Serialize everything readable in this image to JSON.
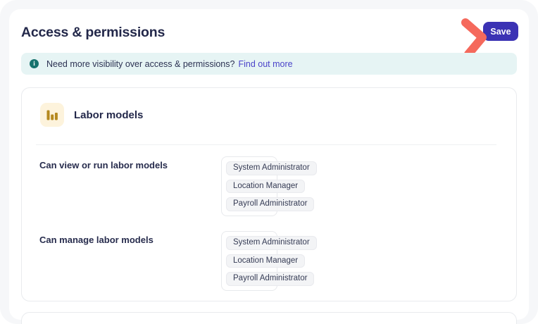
{
  "header": {
    "title": "Access & permissions",
    "save_button": "Save"
  },
  "banner": {
    "icon_glyph": "i",
    "text": "Need more visibility over access & permissions?",
    "link_text": "Find out more"
  },
  "section": {
    "icon": "bar-chart-icon",
    "title": "Labor models",
    "rows": [
      {
        "label": "Can view or run labor models",
        "tags": [
          "System Administrator",
          "Location Manager",
          "Payroll Administrator"
        ]
      },
      {
        "label": "Can manage labor models",
        "tags": [
          "System Administrator",
          "Location Manager",
          "Payroll Administrator"
        ]
      }
    ]
  },
  "colors": {
    "accent_button": "#3b32b4",
    "link": "#4a43c9",
    "banner_bg": "#e6f4f4",
    "info_icon": "#17736e",
    "arrow_annotation": "#f5695c",
    "icon_tile_bg": "#fdf3dc",
    "icon_bars": "#b5891f",
    "heading_text": "#23284a",
    "card_border": "#e9ebee",
    "tag_bg": "#f3f4f6",
    "window_bg": "#f6f7f9"
  }
}
